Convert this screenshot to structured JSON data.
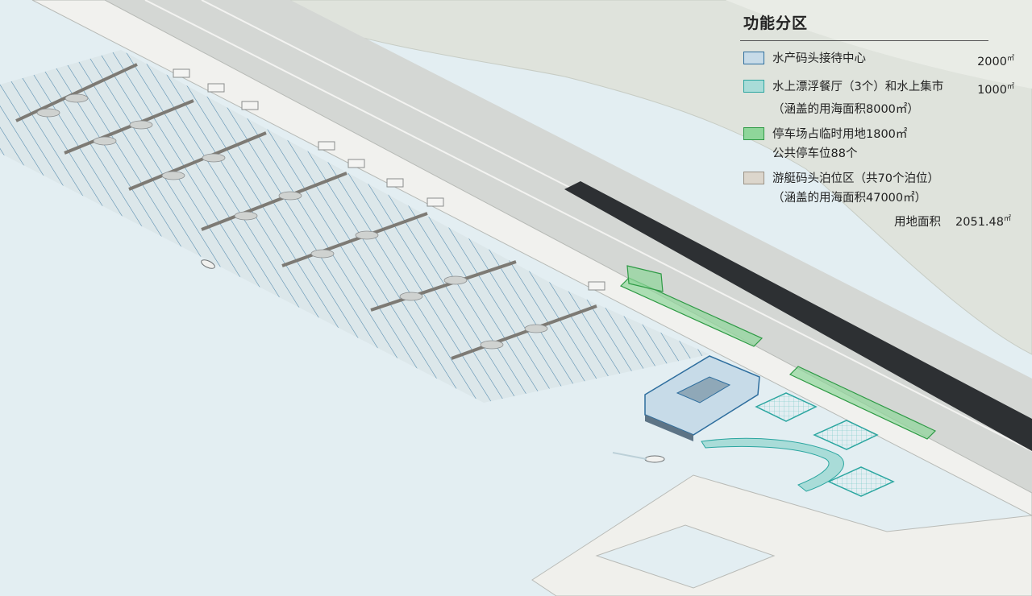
{
  "legend": {
    "title": "功能分区",
    "items": [
      {
        "id": "reception",
        "label": "水产码头接待中心",
        "value": "2000",
        "unit": "㎡",
        "note": "",
        "swatch_fill": "#c7dbe8",
        "swatch_border": "#2e6e9e"
      },
      {
        "id": "restaurant",
        "label": "水上漂浮餐厅（3个）和水上集市",
        "value": "1000",
        "unit": "㎡",
        "note": "（涵盖的用海面积8000㎡）",
        "swatch_fill": "#a9dcd8",
        "swatch_border": "#2ba6a0"
      },
      {
        "id": "parking",
        "label": "停车场占临时用地1800㎡",
        "value": "",
        "unit": "",
        "note": "公共停车位88个",
        "swatch_fill": "#8fd69a",
        "swatch_border": "#2e9a45"
      },
      {
        "id": "berths",
        "label": "游艇码头泊位区（共70个泊位）",
        "value": "",
        "unit": "",
        "note": "（涵盖的用海面积47000㎡）",
        "swatch_fill": "#dcd6cc",
        "swatch_border": "#9a9184"
      }
    ],
    "total": {
      "label": "用地面积",
      "value": "2051.48",
      "unit": "㎡"
    }
  },
  "colors": {
    "water": "#e3eef2",
    "land": "#dfe3dc",
    "road": "#d2d4d2",
    "berth_hatch": "#4f86ab",
    "berth_zone": "#cdd9dc",
    "reception": "#c7dbe8",
    "restaurant": "#a9dcd8",
    "parking": "#8fd69a"
  }
}
